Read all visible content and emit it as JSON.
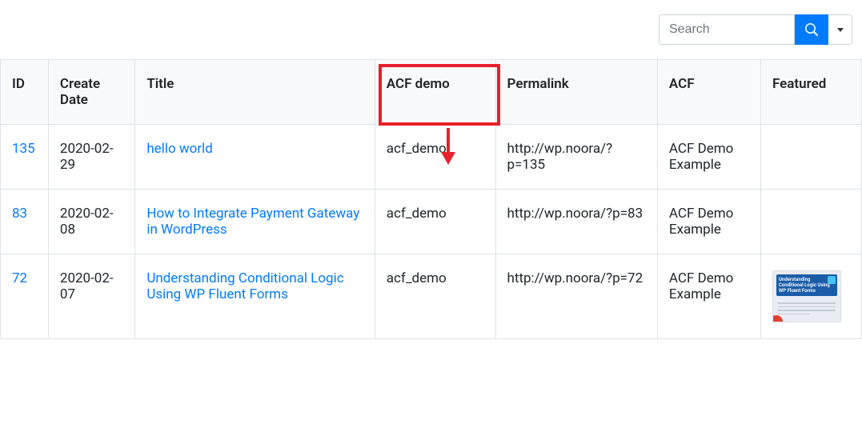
{
  "toolbar": {
    "search_placeholder": "Search"
  },
  "table": {
    "headers": {
      "id": "ID",
      "create_date": "Create Date",
      "title": "Title",
      "acf_demo": "ACF demo",
      "permalink": "Permalink",
      "acf": "ACF",
      "featured": "Featured"
    },
    "rows": [
      {
        "id": "135",
        "create_date": "2020-02-29",
        "title": "hello world",
        "acf_demo": "acf_demo",
        "permalink": "http://wp.noora/?p=135",
        "acf": "ACF Demo Example",
        "featured": null
      },
      {
        "id": "83",
        "create_date": "2020-02-08",
        "title": "How to Integrate Payment Gateway in WordPress",
        "acf_demo": "acf_demo",
        "permalink": "http://wp.noora/?p=83",
        "acf": "ACF Demo Example",
        "featured": null
      },
      {
        "id": "72",
        "create_date": "2020-02-07",
        "title": "Understanding Conditional Logic Using WP Fluent Forms",
        "acf_demo": "acf_demo",
        "permalink": "http://wp.noora/?p=72",
        "acf": "ACF Demo Example",
        "featured_thumb_text": "Understanding Conditional Logic Using WP Fluent Forms"
      }
    ]
  },
  "annotation": {
    "highlight_color": "#e6202c",
    "arrow_color": "#e6202c"
  }
}
